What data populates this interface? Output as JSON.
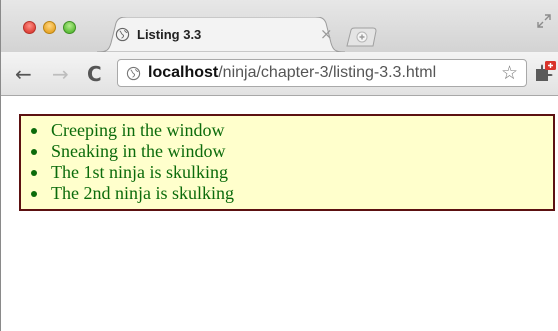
{
  "browser": {
    "tab": {
      "title": "Listing 3.3",
      "close_glyph": "×"
    },
    "icons": {
      "close": "close-window-icon",
      "minimize": "minimize-window-icon",
      "zoom": "zoom-window-icon",
      "favicon": "globe-icon",
      "new_tab": "new-tab-icon",
      "back": "back-arrow-icon",
      "forward": "forward-arrow-icon",
      "reload": "reload-icon",
      "bookmark": "star-icon",
      "extension": "extension-icon",
      "fullscreen": "fullscreen-icon"
    },
    "nav": {
      "back_glyph": "←",
      "forward_glyph": "→",
      "reload_glyph": "C",
      "star_glyph": "☆"
    },
    "address": {
      "host": "localhost",
      "path": "/ninja/chapter-3/listing-3.3.html"
    }
  },
  "page": {
    "items": [
      "Creeping in the window",
      "Sneaking in the window",
      "The 1st ninja is skulking",
      "The 2nd ninja is skulking"
    ],
    "colors": {
      "box_background": "#ffffcc",
      "box_border": "#5c1111",
      "text": "#0b6b0b"
    }
  }
}
